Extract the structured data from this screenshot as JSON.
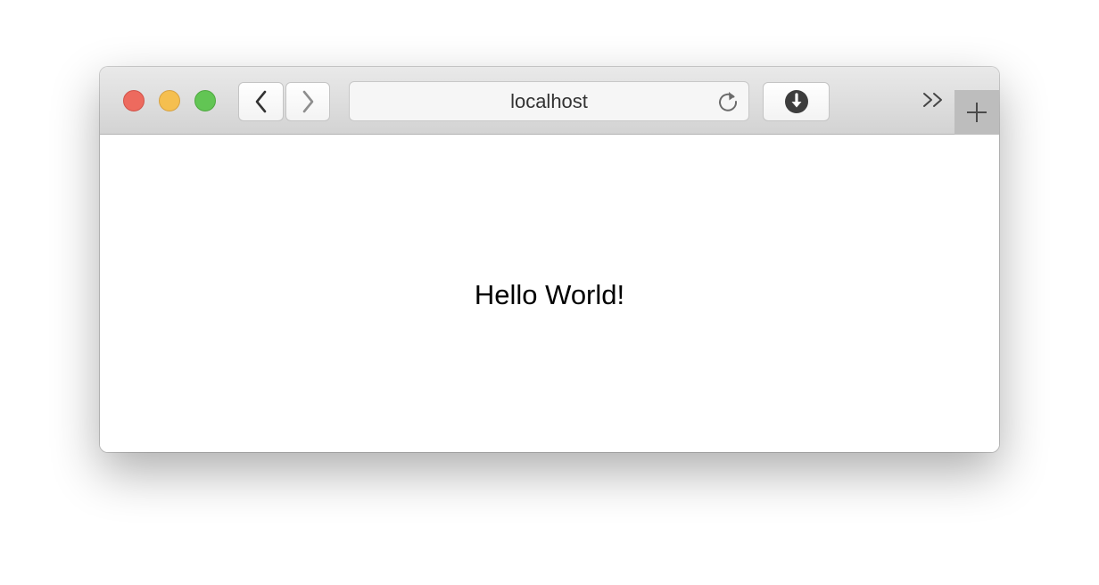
{
  "browser": {
    "address_bar": {
      "url": "localhost"
    },
    "icons": {
      "back": "chevron-left-icon",
      "forward": "chevron-right-icon",
      "reload": "reload-icon",
      "download": "download-icon",
      "overflow": "double-chevron-right-icon",
      "new_tab": "plus-icon"
    },
    "colors": {
      "close": "#ed6a5e",
      "minimize": "#f5bf4f",
      "zoom": "#62c554"
    }
  },
  "page": {
    "text": "Hello World!"
  }
}
